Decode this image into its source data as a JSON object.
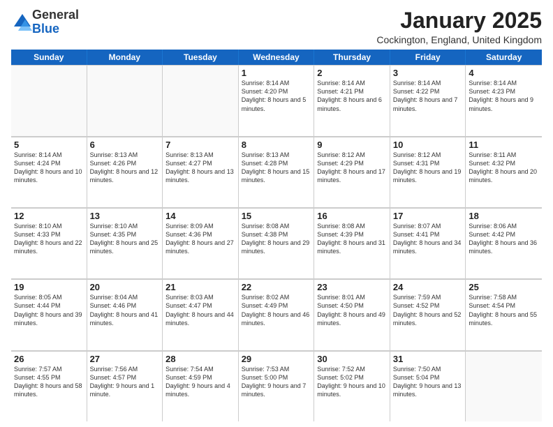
{
  "logo": {
    "general": "General",
    "blue": "Blue"
  },
  "header": {
    "month": "January 2025",
    "location": "Cockington, England, United Kingdom"
  },
  "days": [
    "Sunday",
    "Monday",
    "Tuesday",
    "Wednesday",
    "Thursday",
    "Friday",
    "Saturday"
  ],
  "weeks": [
    [
      {
        "day": "",
        "text": ""
      },
      {
        "day": "",
        "text": ""
      },
      {
        "day": "",
        "text": ""
      },
      {
        "day": "1",
        "text": "Sunrise: 8:14 AM\nSunset: 4:20 PM\nDaylight: 8 hours and 5 minutes."
      },
      {
        "day": "2",
        "text": "Sunrise: 8:14 AM\nSunset: 4:21 PM\nDaylight: 8 hours and 6 minutes."
      },
      {
        "day": "3",
        "text": "Sunrise: 8:14 AM\nSunset: 4:22 PM\nDaylight: 8 hours and 7 minutes."
      },
      {
        "day": "4",
        "text": "Sunrise: 8:14 AM\nSunset: 4:23 PM\nDaylight: 8 hours and 9 minutes."
      }
    ],
    [
      {
        "day": "5",
        "text": "Sunrise: 8:14 AM\nSunset: 4:24 PM\nDaylight: 8 hours and 10 minutes."
      },
      {
        "day": "6",
        "text": "Sunrise: 8:13 AM\nSunset: 4:26 PM\nDaylight: 8 hours and 12 minutes."
      },
      {
        "day": "7",
        "text": "Sunrise: 8:13 AM\nSunset: 4:27 PM\nDaylight: 8 hours and 13 minutes."
      },
      {
        "day": "8",
        "text": "Sunrise: 8:13 AM\nSunset: 4:28 PM\nDaylight: 8 hours and 15 minutes."
      },
      {
        "day": "9",
        "text": "Sunrise: 8:12 AM\nSunset: 4:29 PM\nDaylight: 8 hours and 17 minutes."
      },
      {
        "day": "10",
        "text": "Sunrise: 8:12 AM\nSunset: 4:31 PM\nDaylight: 8 hours and 19 minutes."
      },
      {
        "day": "11",
        "text": "Sunrise: 8:11 AM\nSunset: 4:32 PM\nDaylight: 8 hours and 20 minutes."
      }
    ],
    [
      {
        "day": "12",
        "text": "Sunrise: 8:10 AM\nSunset: 4:33 PM\nDaylight: 8 hours and 22 minutes."
      },
      {
        "day": "13",
        "text": "Sunrise: 8:10 AM\nSunset: 4:35 PM\nDaylight: 8 hours and 25 minutes."
      },
      {
        "day": "14",
        "text": "Sunrise: 8:09 AM\nSunset: 4:36 PM\nDaylight: 8 hours and 27 minutes."
      },
      {
        "day": "15",
        "text": "Sunrise: 8:08 AM\nSunset: 4:38 PM\nDaylight: 8 hours and 29 minutes."
      },
      {
        "day": "16",
        "text": "Sunrise: 8:08 AM\nSunset: 4:39 PM\nDaylight: 8 hours and 31 minutes."
      },
      {
        "day": "17",
        "text": "Sunrise: 8:07 AM\nSunset: 4:41 PM\nDaylight: 8 hours and 34 minutes."
      },
      {
        "day": "18",
        "text": "Sunrise: 8:06 AM\nSunset: 4:42 PM\nDaylight: 8 hours and 36 minutes."
      }
    ],
    [
      {
        "day": "19",
        "text": "Sunrise: 8:05 AM\nSunset: 4:44 PM\nDaylight: 8 hours and 39 minutes."
      },
      {
        "day": "20",
        "text": "Sunrise: 8:04 AM\nSunset: 4:46 PM\nDaylight: 8 hours and 41 minutes."
      },
      {
        "day": "21",
        "text": "Sunrise: 8:03 AM\nSunset: 4:47 PM\nDaylight: 8 hours and 44 minutes."
      },
      {
        "day": "22",
        "text": "Sunrise: 8:02 AM\nSunset: 4:49 PM\nDaylight: 8 hours and 46 minutes."
      },
      {
        "day": "23",
        "text": "Sunrise: 8:01 AM\nSunset: 4:50 PM\nDaylight: 8 hours and 49 minutes."
      },
      {
        "day": "24",
        "text": "Sunrise: 7:59 AM\nSunset: 4:52 PM\nDaylight: 8 hours and 52 minutes."
      },
      {
        "day": "25",
        "text": "Sunrise: 7:58 AM\nSunset: 4:54 PM\nDaylight: 8 hours and 55 minutes."
      }
    ],
    [
      {
        "day": "26",
        "text": "Sunrise: 7:57 AM\nSunset: 4:55 PM\nDaylight: 8 hours and 58 minutes."
      },
      {
        "day": "27",
        "text": "Sunrise: 7:56 AM\nSunset: 4:57 PM\nDaylight: 9 hours and 1 minute."
      },
      {
        "day": "28",
        "text": "Sunrise: 7:54 AM\nSunset: 4:59 PM\nDaylight: 9 hours and 4 minutes."
      },
      {
        "day": "29",
        "text": "Sunrise: 7:53 AM\nSunset: 5:00 PM\nDaylight: 9 hours and 7 minutes."
      },
      {
        "day": "30",
        "text": "Sunrise: 7:52 AM\nSunset: 5:02 PM\nDaylight: 9 hours and 10 minutes."
      },
      {
        "day": "31",
        "text": "Sunrise: 7:50 AM\nSunset: 5:04 PM\nDaylight: 9 hours and 13 minutes."
      },
      {
        "day": "",
        "text": ""
      }
    ]
  ]
}
